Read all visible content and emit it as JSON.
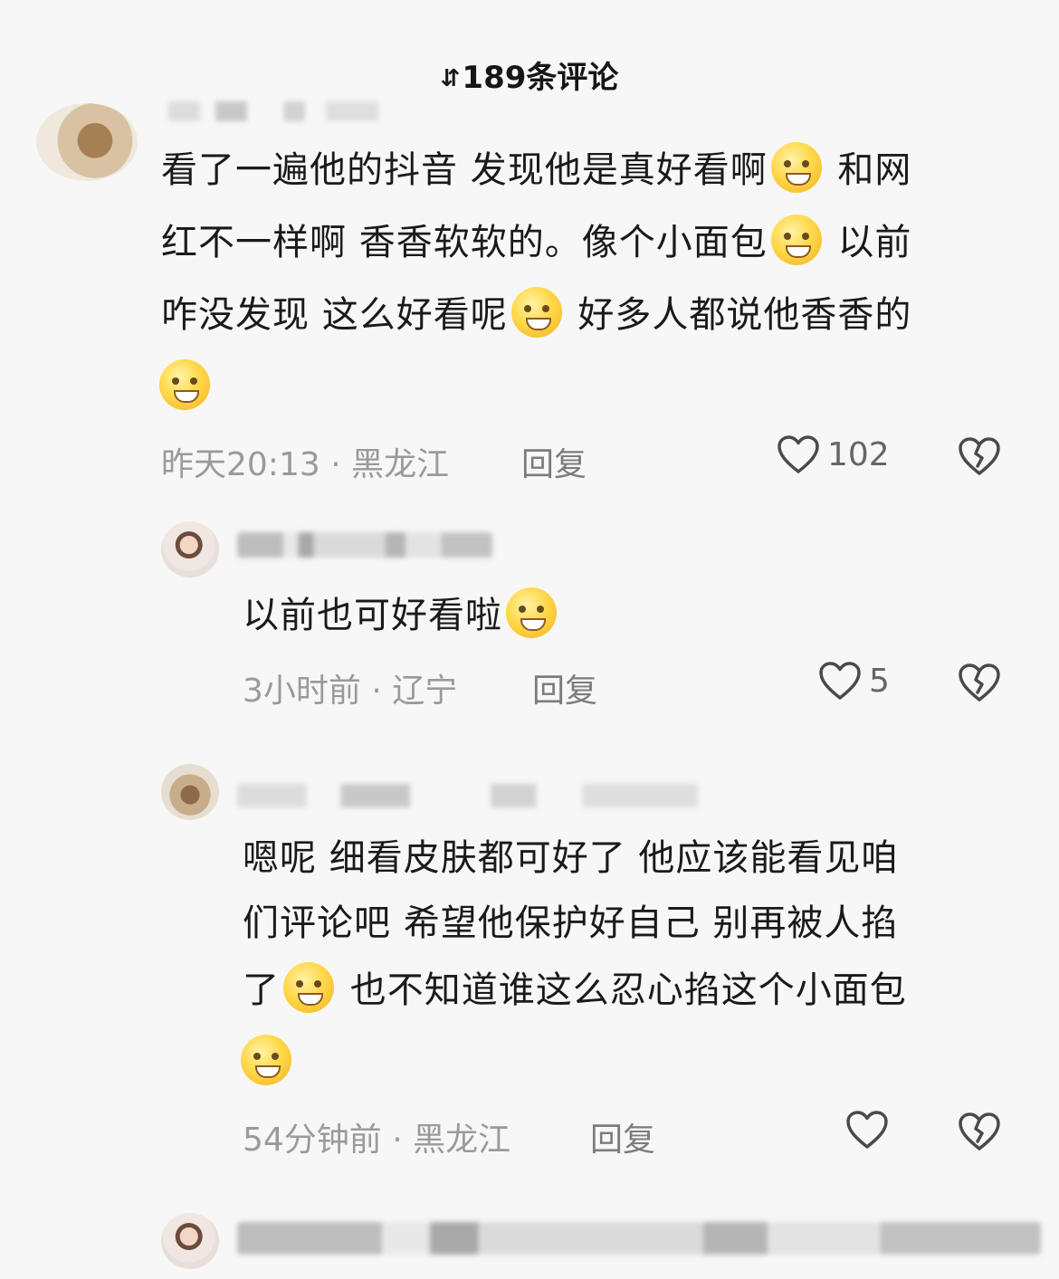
{
  "header": {
    "mark": "⇵",
    "title": "189条评论"
  },
  "comments": [
    {
      "lines": [
        [
          "看了一遍他的抖音 发现他是真好看啊",
          "emoji",
          " 和网"
        ],
        [
          "红不一样啊 香香软软的。像个小面包",
          "emoji",
          " 以前"
        ],
        [
          "咋没发现 这么好看呢",
          "emoji",
          " 好多人都说他香香的"
        ],
        [
          "",
          "emoji",
          ""
        ]
      ],
      "time": "昨天20:13",
      "sep": "·",
      "location": "黑龙江",
      "reply": "回复",
      "likes": "102"
    },
    {
      "lines": [
        [
          "以前也可好看啦",
          "emoji",
          ""
        ]
      ],
      "time": "3小时前",
      "sep": "·",
      "location": "辽宁",
      "reply": "回复",
      "likes": "5"
    },
    {
      "lines": [
        [
          "嗯呢 细看皮肤都可好了 他应该能看见咱"
        ],
        [
          "们评论吧 希望他保护好自己 别再被人掐"
        ],
        [
          "了",
          "emoji",
          " 也不知道谁这么忍心掐这个小面包"
        ],
        [
          "",
          "emoji",
          ""
        ]
      ],
      "time": "54分钟前",
      "sep": "·",
      "location": "黑龙江",
      "reply": "回复",
      "likes": ""
    }
  ],
  "icons": {
    "like": "heart-outline-icon",
    "dislike": "broken-heart-icon"
  },
  "colors": {
    "background": "#f7f7f7",
    "text": "#1a1a1a",
    "meta": "#9a9a9a",
    "reply": "#7c7c7c"
  }
}
